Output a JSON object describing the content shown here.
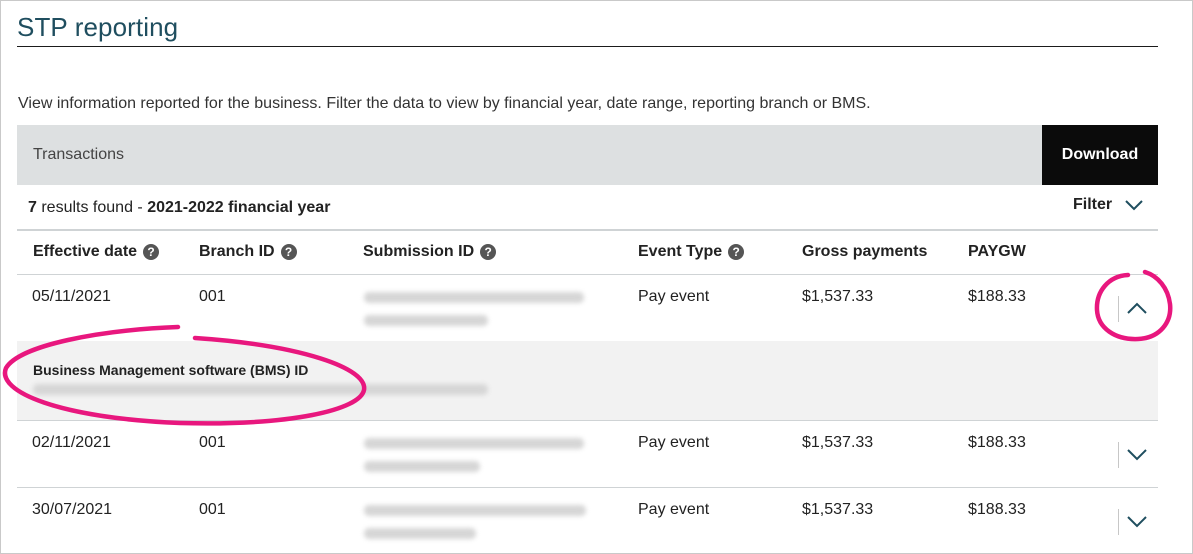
{
  "page": {
    "title": "STP reporting",
    "intro": "View information reported for the business. Filter the data to view by financial year, date range, reporting branch or BMS."
  },
  "transactions": {
    "label": "Transactions",
    "download_label": "Download"
  },
  "results": {
    "count": "7",
    "text": " results found - ",
    "year": "2021-2022 financial year"
  },
  "filter": {
    "label": "Filter",
    "icon": "chevron-down-icon"
  },
  "columns": {
    "effective_date": "Effective date",
    "branch_id": "Branch ID",
    "submission_id": "Submission ID",
    "event_type": "Event Type",
    "gross_payments": "Gross payments",
    "paygw": "PAYGW",
    "help_icon": "?"
  },
  "rows": [
    {
      "effective_date": "05/11/2021",
      "branch_id": "001",
      "event_type": "Pay event",
      "gross_payments": "$1,537.33",
      "paygw": "$188.33",
      "expanded": true
    },
    {
      "effective_date": "02/11/2021",
      "branch_id": "001",
      "event_type": "Pay event",
      "gross_payments": "$1,537.33",
      "paygw": "$188.33",
      "expanded": false
    },
    {
      "effective_date": "30/07/2021",
      "branch_id": "001",
      "event_type": "Pay event",
      "gross_payments": "$1,537.33",
      "paygw": "$188.33",
      "expanded": false
    }
  ],
  "expanded_detail": {
    "bms_label": "Business Management software (BMS) ID"
  },
  "colors": {
    "title": "#1f4e5f",
    "annotation": "#e8177e",
    "chevron": "#1f4e5f",
    "bar": "#dde0e1",
    "download_bg": "#0b0b0b"
  }
}
